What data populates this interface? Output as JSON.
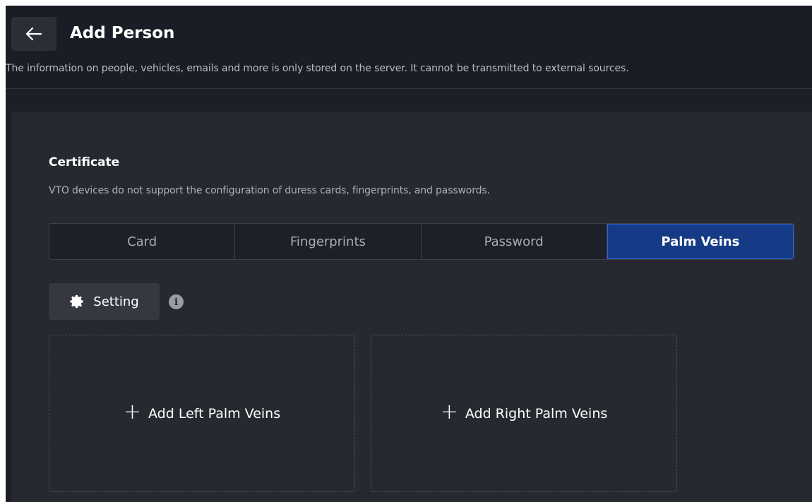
{
  "header": {
    "title": "Add Person",
    "notice": "The information on people, vehicles, emails and more is only stored on the server. It cannot be transmitted to external sources."
  },
  "certificate": {
    "title": "Certificate",
    "note": "VTO devices do not support the configuration of duress cards, fingerprints, and passwords.",
    "tabs": [
      {
        "label": "Card"
      },
      {
        "label": "Fingerprints"
      },
      {
        "label": "Password"
      },
      {
        "label": "Palm Veins"
      }
    ],
    "active_tab": "Palm Veins",
    "setting_label": "Setting",
    "info_glyph": "i",
    "add_left_label": "Add Left Palm Veins",
    "add_right_label": "Add Right Palm Veins"
  },
  "colors": {
    "background": "#1c1f28",
    "panel": "#262930",
    "accent": "#163b86",
    "accent_border": "#2f64d8"
  }
}
